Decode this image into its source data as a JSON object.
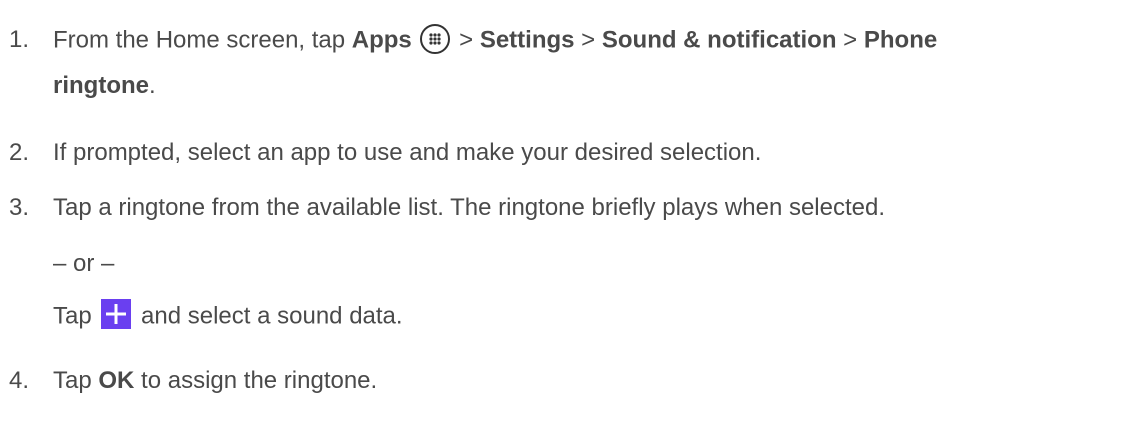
{
  "steps": [
    {
      "number": "1.",
      "line1": {
        "t1": "From the Home screen, tap ",
        "apps": "Apps",
        "t2": " > ",
        "settings": "Settings",
        "t3": " > ",
        "sound": "Sound & notification",
        "t4": " > ",
        "phone": "Phone"
      },
      "line2": {
        "ringtone": "ringtone",
        "end": "."
      }
    },
    {
      "number": "2.",
      "text": "If prompted, select an app to use and make your desired selection."
    },
    {
      "number": "3.",
      "text": "Tap a ringtone from the available list. The ringtone briefly plays when selected.",
      "or": "– or –",
      "alt_t1": "Tap ",
      "alt_t2": " and select a sound data."
    },
    {
      "number": "4.",
      "t1": "Tap ",
      "ok": "OK",
      "t2": " to assign the ringtone."
    }
  ],
  "icons": {
    "apps": "apps-grid-icon",
    "add": "plus-icon",
    "add_color": "#6a3ff0"
  }
}
